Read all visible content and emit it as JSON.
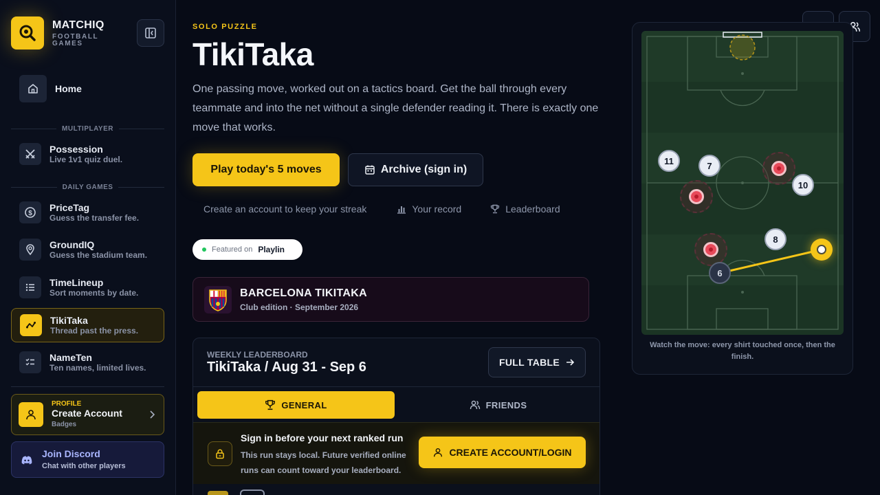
{
  "brand": {
    "name": "MATCHIQ",
    "subtitle_line1": "FOOTBALL",
    "subtitle_line2": "GAMES"
  },
  "sidebar": {
    "home": {
      "label": "Home"
    },
    "section_multiplayer": "MULTIPLAYER",
    "section_daily": "DAILY GAMES",
    "items": [
      {
        "title": "Possession",
        "desc": "Live 1v1 quiz duel."
      },
      {
        "title": "PriceTag",
        "desc": "Guess the transfer fee."
      },
      {
        "title": "GroundIQ",
        "desc": "Guess the stadium team."
      },
      {
        "title": "TimeLineup",
        "desc": "Sort moments by date."
      },
      {
        "title": "TikiTaka",
        "desc": "Thread past the press."
      },
      {
        "title": "NameTen",
        "desc": "Ten names, limited lives."
      }
    ],
    "profile": {
      "tag": "PROFILE",
      "title": "Create Account",
      "sub": "Badges"
    },
    "discord": {
      "title": "Join Discord",
      "sub": "Chat with other players"
    }
  },
  "main": {
    "eyebrow": "SOLO PUZZLE",
    "title": "TikiTaka",
    "description": "One passing move, worked out on a tactics board. Get the ball through every teammate and into the net without a single defender reading it. There is exactly one move that works.",
    "primary_button": "Play today's 5 moves",
    "secondary_button": "Archive (sign in)",
    "links": {
      "streak": "Create an account to keep your streak",
      "record": "Your record",
      "leaderboard": "Leaderboard"
    },
    "featured": {
      "prefix": "Featured on",
      "name": "Playlin"
    },
    "club": {
      "title": "BARCELONA TIKITAKA",
      "subtitle": "Club edition · September 2026"
    },
    "leaderboard": {
      "eyebrow": "WEEKLY LEADERBOARD",
      "title": "TikiTaka / Aug 31 - Sep 6",
      "full_table": "FULL TABLE",
      "tab_general": "GENERAL",
      "tab_friends": "FRIENDS",
      "signin_title": "Sign in before your next ranked run",
      "signin_desc": "This run stays local. Future verified online runs can count toward your leaderboard.",
      "signin_button": "CREATE ACCOUNT/LOGIN"
    }
  },
  "board": {
    "players": [
      "11",
      "7",
      "10",
      "8",
      "6"
    ],
    "caption": "Watch the move: every shirt touched once, then the finish."
  },
  "colors": {
    "accent": "#f5c518",
    "background": "#070b16",
    "pitch": "#1d3a26",
    "defender": "#e84a5a"
  }
}
